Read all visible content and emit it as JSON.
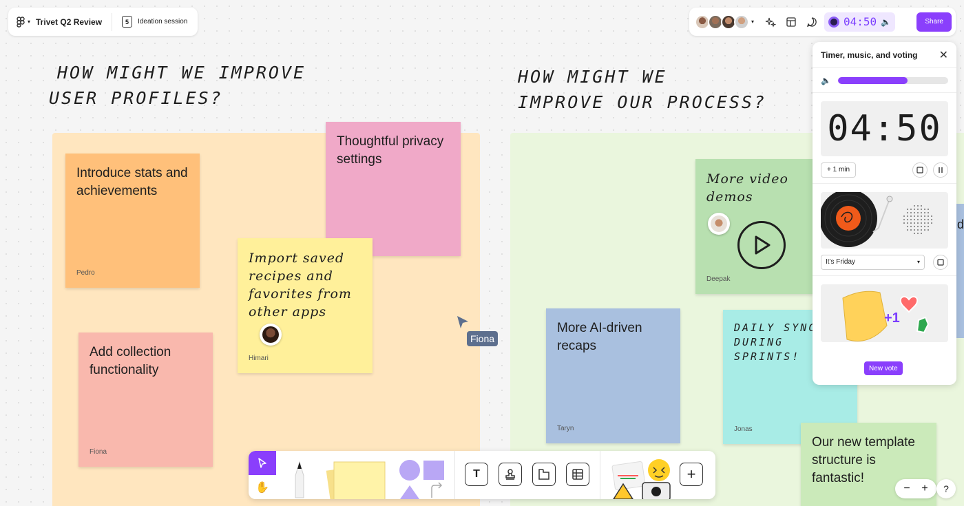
{
  "file": {
    "title": "Trivet Q2 Review",
    "page_number": "5",
    "page_name": "Ideation session"
  },
  "toolbar": {
    "timer": "04:50",
    "share_label": "Share"
  },
  "headings": {
    "left_line1": "HOW MIGHT WE IMPROVE",
    "left_line2": "USER PROFILES?",
    "right_line1": "HOW MIGHT WE",
    "right_line2": "IMPROVE OUR PROCESS?"
  },
  "stickies": {
    "stats": {
      "text": "Introduce stats and achievements",
      "author": "Pedro"
    },
    "privacy": {
      "text": "Thoughtful privacy settings"
    },
    "import": {
      "text": "Import saved recipes and favorites from other apps",
      "author": "Himari"
    },
    "collection": {
      "text": "Add collection functionality",
      "author": "Fiona"
    },
    "video": {
      "text": "More video demos",
      "author": "Deepak"
    },
    "recaps": {
      "text": "More AI-driven recaps",
      "author": "Taryn"
    },
    "sync": {
      "text": "DAILY SYNCS DURING SPRINTS!",
      "author": "Jonas"
    },
    "template": {
      "text": "Our new template structure is fantastic!"
    },
    "edge_letter": "d"
  },
  "cursor": {
    "name": "Fiona"
  },
  "panel": {
    "title": "Timer, music, and voting",
    "volume": 0.63,
    "timer": "04:50",
    "add_minute": "+ 1 min",
    "song": "It's Friday",
    "new_vote": "New vote"
  },
  "colors": {
    "accent": "#8a3ffc"
  }
}
